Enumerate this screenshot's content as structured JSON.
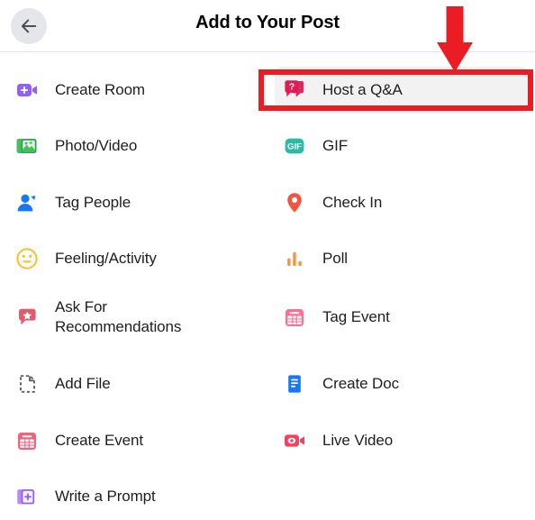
{
  "header": {
    "back_icon": "arrow-left-icon",
    "title": "Add to Your Post"
  },
  "colors": {
    "accent_annotation": "#ec1c24",
    "highlight_row_bg": "#f2f2f2",
    "text_primary": "#1c1e21",
    "divider": "#e4e6eb",
    "back_button_bg": "#e4e6eb",
    "icon_create_room": "#9360f7",
    "icon_photo_video": "#45bd62",
    "icon_tag_people": "#1877f2",
    "icon_feeling": "#f5c33b",
    "icon_recommendations": "#e35a6f",
    "icon_add_file": "#58606e",
    "icon_create_event": "#f5607a",
    "icon_write_prompt": "#9360f7",
    "icon_qanda": "#d92b5c",
    "icon_gif": "#2abba7",
    "icon_check_in": "#f5533d",
    "icon_poll": "#f7923b",
    "icon_tag_event": "#fa7093",
    "icon_create_doc": "#1877f2",
    "icon_live_video": "#f3425f"
  },
  "menu": {
    "left_column": [
      {
        "label": "Create Room",
        "icon": "video-camera-plus-icon"
      },
      {
        "label": "Photo/Video",
        "icon": "photo-stack-icon"
      },
      {
        "label": "Tag People",
        "icon": "person-tag-icon"
      },
      {
        "label": "Feeling/Activity",
        "icon": "smiley-face-icon"
      },
      {
        "label": "Ask For\nRecommendations",
        "icon": "speech-bubble-star-icon"
      },
      {
        "label": "Add File",
        "icon": "file-dashed-icon"
      },
      {
        "label": "Create Event",
        "icon": "calendar-icon"
      },
      {
        "label": "Write a Prompt",
        "icon": "card-plus-icon"
      }
    ],
    "right_column": [
      {
        "label": "Host a Q&A",
        "icon": "question-bubble-icon",
        "highlighted": true
      },
      {
        "label": "GIF",
        "icon": "gif-icon"
      },
      {
        "label": "Check In",
        "icon": "location-pin-icon"
      },
      {
        "label": "Poll",
        "icon": "bar-chart-icon"
      },
      {
        "label": "Tag Event",
        "icon": "calendar-icon"
      },
      {
        "label": "Create Doc",
        "icon": "document-icon"
      },
      {
        "label": "Live Video",
        "icon": "live-video-icon"
      }
    ]
  },
  "annotation": {
    "highlight_target": "Host a Q&A",
    "arrow_icon": "down-arrow-annotation",
    "arrow_color": "#ec1c24",
    "box_color": "#ec1c24"
  }
}
